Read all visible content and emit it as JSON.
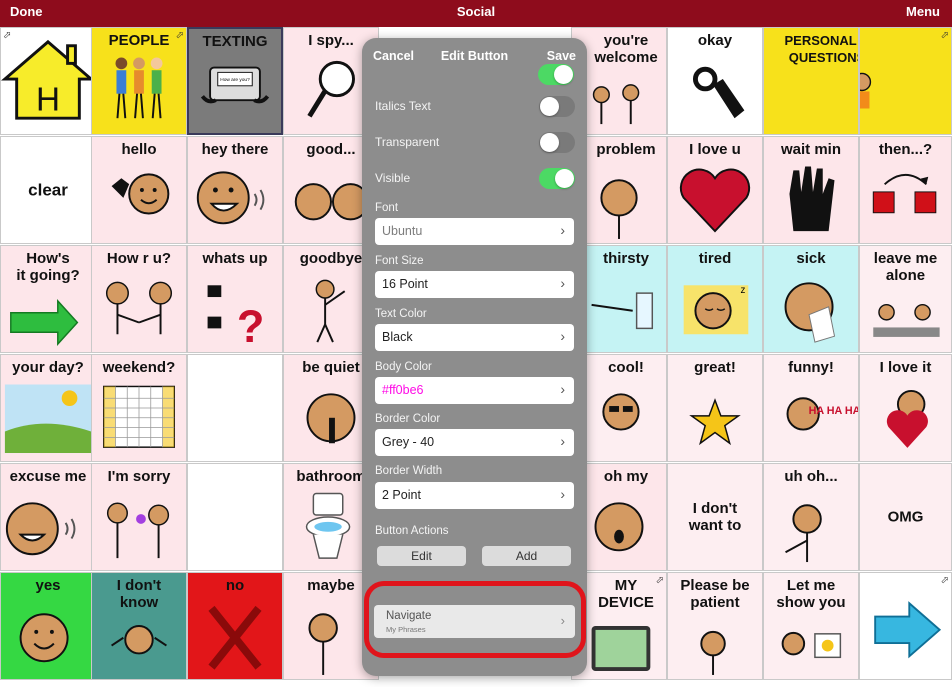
{
  "topbar": {
    "done_label": "Done",
    "title": "Social",
    "menu_label": "Menu"
  },
  "cells": {
    "personal_questions": "PERSONAL &\nQUESTIONS",
    "people": "PEOPLE",
    "texting": "TEXTING",
    "i_spy": "I spy...",
    "youre_welcome": "you're\nwelcome",
    "okay": "okay",
    "clear": "clear",
    "hello": "hello",
    "hey_there": "hey there",
    "good": "good...",
    "problem": "problem",
    "i_love_u": "I love u",
    "wait_min": "wait min",
    "then": "then...?",
    "hows_it_going": "How's\nit going?",
    "how_r_u": "How r u?",
    "whats_up": "whats up",
    "goodbye": "goodbye",
    "thirsty": "thirsty",
    "tired": "tired",
    "sick": "sick",
    "leave_me_alone": "leave me\nalone",
    "your_day": "your day?",
    "weekend": "weekend?",
    "be_quiet": "be quiet",
    "cool": "cool!",
    "great": "great!",
    "funny": "funny!",
    "i_love_it": "I love it",
    "excuse_me": "excuse me",
    "im_sorry": "I'm sorry",
    "bathroom": "bathroom",
    "oh_my": "oh my",
    "i_dont_want_to": "I don't\nwant to",
    "uh_oh": "uh oh...",
    "omg": "OMG",
    "yes": "yes",
    "i_dont_know": "I don't\nknow",
    "no": "no",
    "maybe": "maybe",
    "my_device": "MY\nDEVICE",
    "please_be_patient": "Please be\npatient",
    "let_me_show_you": "Let me\nshow you"
  },
  "picture_text": {
    "texting_screen": "How are you?",
    "funny_haha": "HA HA HA"
  },
  "edit_panel": {
    "cancel_label": "Cancel",
    "title": "Edit Button",
    "save_label": "Save",
    "toggles": [
      {
        "label": "Italics Text",
        "on": false
      },
      {
        "label": "Transparent",
        "on": false
      },
      {
        "label": "Visible",
        "on": true
      }
    ],
    "font_label": "Font",
    "font_value": "Ubuntu",
    "font_size_label": "Font Size",
    "font_size_value": "16 Point",
    "text_color_label": "Text Color",
    "text_color_value": "Black",
    "body_color_label": "Body Color",
    "body_color_value": "#ff0be6",
    "border_color_label": "Border Color",
    "border_color_value": "Grey - 40",
    "border_width_label": "Border Width",
    "border_width_value": "2 Point",
    "button_actions_label": "Button Actions",
    "edit_action_label": "Edit",
    "add_action_label": "Add",
    "navigate_title": "Navigate",
    "navigate_subtitle": "My Phrases"
  },
  "colors": {
    "topbar": "#8e0c1c",
    "accent_toggle": "#4cd964",
    "highlight": "#e0141b",
    "body_color_text": "#ff0be6"
  }
}
